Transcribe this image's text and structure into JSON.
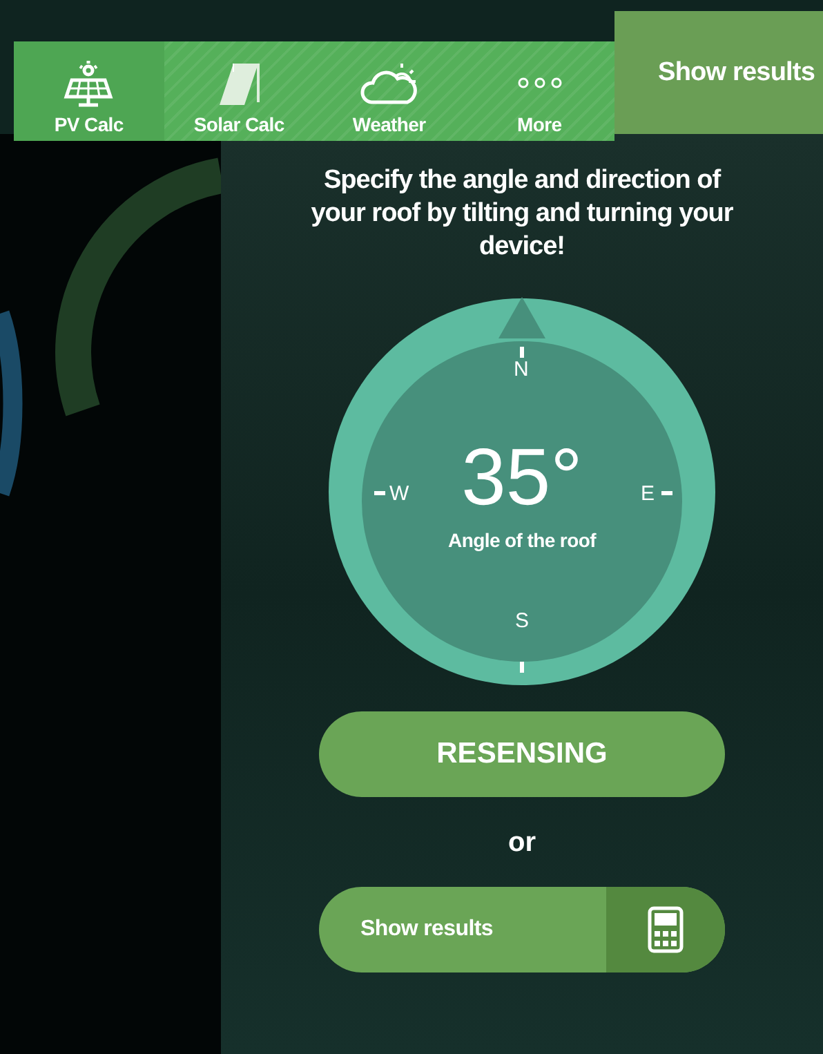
{
  "tabs": [
    {
      "label": "PV Calc",
      "kind": "panel",
      "selected": true
    },
    {
      "label": "Solar Calc",
      "kind": "collector",
      "selected": false
    },
    {
      "label": "Weather",
      "kind": "weather",
      "selected": false
    },
    {
      "label": "More",
      "kind": "more",
      "selected": false
    }
  ],
  "header": {
    "button": "Show results"
  },
  "instruction": "Specify the angle and direction of your roof by tilting and turning your device!",
  "compass": {
    "angle": "35°",
    "caption": "Angle of the roof",
    "north": "N",
    "south": "S",
    "east": "E",
    "west": "W"
  },
  "resensing_button": "RESENSING",
  "separator": "or",
  "results_button": "Show results"
}
